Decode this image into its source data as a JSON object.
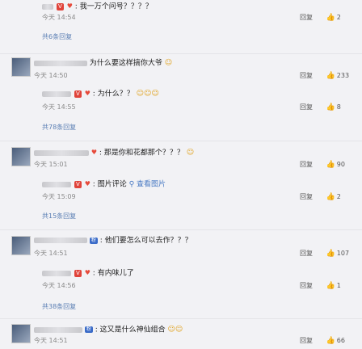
{
  "threads": [
    {
      "replies": [
        {
          "text": ": 我一万个问号？？？？",
          "time": "今天 14:54",
          "reply_label": "回复",
          "likes": "2"
        }
      ],
      "reply_count": "共6条回复"
    },
    {
      "main": {
        "text": "为什么要这样搞你大爷",
        "time": "今天 14:50",
        "reply_label": "回复",
        "likes": "233"
      },
      "replies": [
        {
          "text": ": 为什么？？",
          "time": "今天 14:55",
          "reply_label": "回复",
          "likes": "8"
        }
      ],
      "reply_count": "共78条回复"
    },
    {
      "main": {
        "text": ": 那是你和花都那个？？？",
        "time": "今天 15:01",
        "reply_label": "回复",
        "likes": "90"
      },
      "replies": [
        {
          "text": ": 图片评论",
          "link": "查看图片",
          "time": "今天 15:09",
          "reply_label": "回复",
          "likes": "2"
        }
      ],
      "reply_count": "共15条回复"
    },
    {
      "main": {
        "text": ": 他们要怎么可以去作？？？",
        "time": "今天 14:51",
        "reply_label": "回复",
        "likes": "107"
      },
      "replies": [
        {
          "text": ": 有内味儿了",
          "time": "今天 14:56",
          "reply_label": "回复",
          "likes": "1"
        }
      ],
      "reply_count": "共38条回复"
    },
    {
      "main": {
        "text": ": 这又是什么神仙组合",
        "time": "今天 14:51",
        "reply_label": "回复",
        "likes": "66"
      }
    }
  ],
  "colors": {
    "background": "#f2f2f5",
    "link": "#5b7fb4",
    "badge": "#e0433a"
  }
}
